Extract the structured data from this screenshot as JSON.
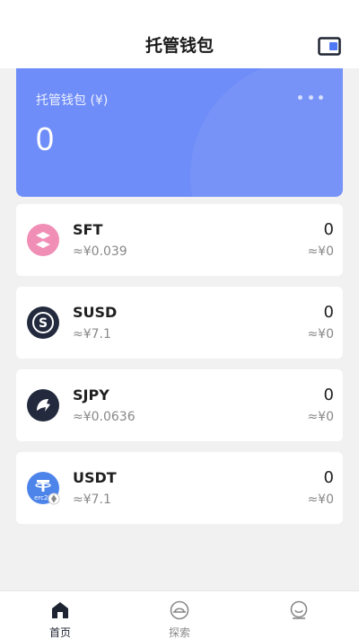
{
  "header": {
    "title": "托管钱包",
    "wallet_icon": "wallet-icon"
  },
  "balance": {
    "label": "托管钱包 (¥)",
    "value": "0",
    "menu_icon": "more-dots-icon",
    "card_color": "#6f8df8"
  },
  "tokens": [
    {
      "symbol": "SFT",
      "price": "≈¥0.039",
      "amount": "0",
      "value": "≈¥0",
      "icon": "sft-icon",
      "color": "#f08eb6"
    },
    {
      "symbol": "SUSD",
      "price": "≈¥7.1",
      "amount": "0",
      "value": "≈¥0",
      "icon": "susd-icon",
      "color": "#232a3d"
    },
    {
      "symbol": "SJPY",
      "price": "≈¥0.0636",
      "amount": "0",
      "value": "≈¥0",
      "icon": "sjpy-icon",
      "color": "#232a3d"
    },
    {
      "symbol": "USDT",
      "price": "≈¥7.1",
      "amount": "0",
      "value": "≈¥0",
      "icon": "usdt-icon",
      "color": "#4d84ea",
      "badge": "erc20"
    }
  ],
  "tabbar": {
    "items": [
      {
        "label": "首页",
        "icon": "home-icon",
        "active": true
      },
      {
        "label": "探索",
        "icon": "explore-icon",
        "active": false
      },
      {
        "label": "",
        "icon": "profile-icon",
        "active": false
      }
    ],
    "active_color": "#1f2433",
    "inactive_color": "#8a8a8a"
  }
}
